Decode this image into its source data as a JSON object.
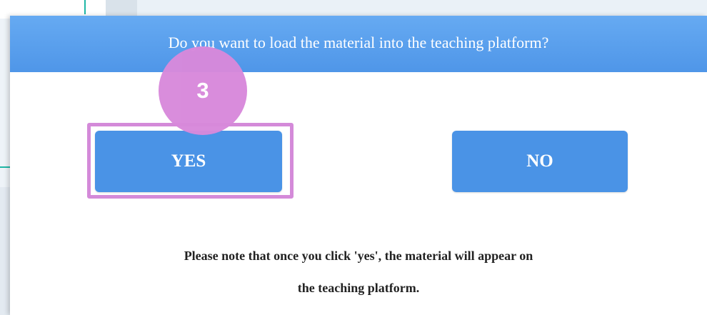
{
  "dialog": {
    "question": "Do you want to load the material into the teaching platform?",
    "yes_label": "YES",
    "no_label": "NO",
    "note_line1": "Please note that once you click 'yes', the material will appear on",
    "note_line2": "the teaching platform."
  },
  "annotation": {
    "step_number": "3"
  },
  "colors": {
    "header_blue": "#5a9fee",
    "button_blue": "#4a93e6",
    "highlight_pink": "#d48ad9",
    "badge_pink": "#d889db",
    "teal_accent": "#1fb7a6"
  }
}
